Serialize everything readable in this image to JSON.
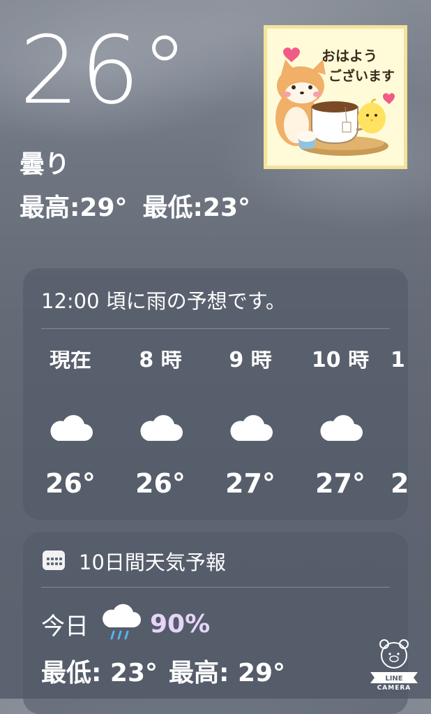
{
  "current": {
    "temperature": "26°",
    "condition": "曇り",
    "high": "最高:29°",
    "low": "最低:23°"
  },
  "sticker": {
    "greeting_line1": "おはよう",
    "greeting_line2": "ございます"
  },
  "hourly": {
    "summary": "12:00 頃に雨の予想です。",
    "hours": [
      {
        "label": "現在",
        "icon": "cloud-icon",
        "temp": "26°"
      },
      {
        "label": "8 時",
        "icon": "cloud-icon",
        "temp": "26°"
      },
      {
        "label": "9 時",
        "icon": "cloud-icon",
        "temp": "27°"
      },
      {
        "label": "10 時",
        "icon": "cloud-icon",
        "temp": "27°"
      },
      {
        "label": "1",
        "icon": "",
        "temp": "2"
      }
    ]
  },
  "daily": {
    "title": "10日間天気予報",
    "icon": "calendar-icon",
    "days": [
      {
        "name": "今日",
        "icon": "rain-cloud-icon",
        "precip": "90%",
        "low": "最低: 23°",
        "high": "最高: 29°"
      }
    ]
  },
  "watermark": {
    "text_line1": "LINE",
    "text_line2": "CAMERA"
  },
  "colors": {
    "precip_text": "#e7d4f9",
    "rain_drop": "#58b4f0",
    "card_bg": "rgba(80,88,102,0.55)"
  }
}
